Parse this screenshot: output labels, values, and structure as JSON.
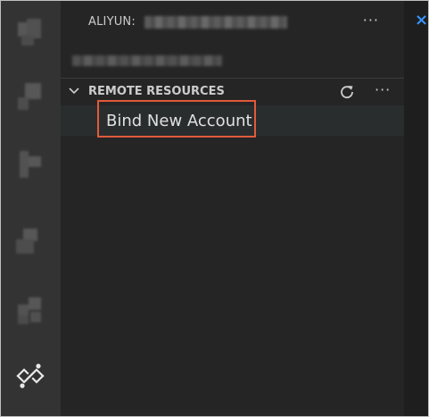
{
  "explorer": {
    "title_prefix": "ALIYUN:",
    "title_more": "···"
  },
  "section": {
    "title": "REMOTE RESOURCES",
    "more": "···"
  },
  "tree": {
    "items": [
      {
        "label": "Bind New Account"
      }
    ]
  },
  "editor": {
    "close_glyph": "×"
  },
  "colors": {
    "highlight": "#e05a3a",
    "close_blue": "#3794ff",
    "sidebar_bg": "#252526",
    "activity_bg": "#333333"
  }
}
